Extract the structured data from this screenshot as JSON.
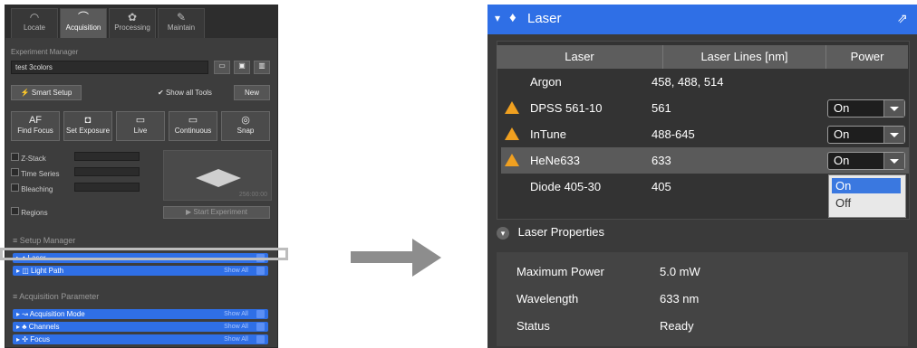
{
  "left_panel": {
    "tabs": [
      {
        "label": "Locate",
        "icon": "locate-icon"
      },
      {
        "label": "Acquisition",
        "icon": "acquisition-icon"
      },
      {
        "label": "Processing",
        "icon": "processing-icon"
      },
      {
        "label": "Maintain",
        "icon": "maintain-icon"
      }
    ],
    "experiment_manager_label": "Experiment Manager",
    "experiment_name": "test 3colors",
    "smart_setup_label": "Smart Setup",
    "show_all_tools_label": "Show all Tools",
    "new_label": "New",
    "tools": [
      {
        "label": "Find Focus",
        "icon_text": "AF"
      },
      {
        "label": "Set Exposure",
        "icon_text": "◘"
      },
      {
        "label": "Live",
        "icon_text": "▭"
      },
      {
        "label": "Continuous",
        "icon_text": "▭"
      },
      {
        "label": "Snap",
        "icon_text": "◎"
      }
    ],
    "options": [
      "Z-Stack",
      "Time Series",
      "Bleaching",
      "Regions"
    ],
    "preview_time": "256:00:00",
    "start_experiment_label": "Start Experiment",
    "setup_manager_label": "Setup Manager",
    "setup_items": [
      {
        "label": "Laser",
        "show_all": ""
      },
      {
        "label": "Light Path",
        "show_all": "Show All"
      }
    ],
    "acquisition_parameter_label": "Acquisition Parameter",
    "acq_items": [
      {
        "label": "Acquisition Mode",
        "show_all": "Show All"
      },
      {
        "label": "Channels",
        "show_all": "Show All"
      },
      {
        "label": "Focus",
        "show_all": "Show All"
      }
    ]
  },
  "laser_panel": {
    "title": "Laser",
    "columns": [
      "Laser",
      "Laser Lines [nm]",
      "Power"
    ],
    "rows": [
      {
        "name": "Argon",
        "lines": "458, 488, 514",
        "power": "",
        "warning": false
      },
      {
        "name": "DPSS 561-10",
        "lines": "561",
        "power": "On",
        "warning": true
      },
      {
        "name": "InTune",
        "lines": "488-645",
        "power": "On",
        "warning": true
      },
      {
        "name": "HeNe633",
        "lines": "633",
        "power": "On",
        "warning": true
      },
      {
        "name": "Diode 405-30",
        "lines": "405",
        "power": "",
        "warning": false
      }
    ],
    "power_options": [
      "On",
      "Off"
    ],
    "properties_title": "Laser Properties",
    "properties": [
      {
        "label": "Maximum Power",
        "value": "5.0 mW"
      },
      {
        "label": "Wavelength",
        "value": "633 nm"
      },
      {
        "label": "Status",
        "value": "Ready"
      }
    ]
  }
}
